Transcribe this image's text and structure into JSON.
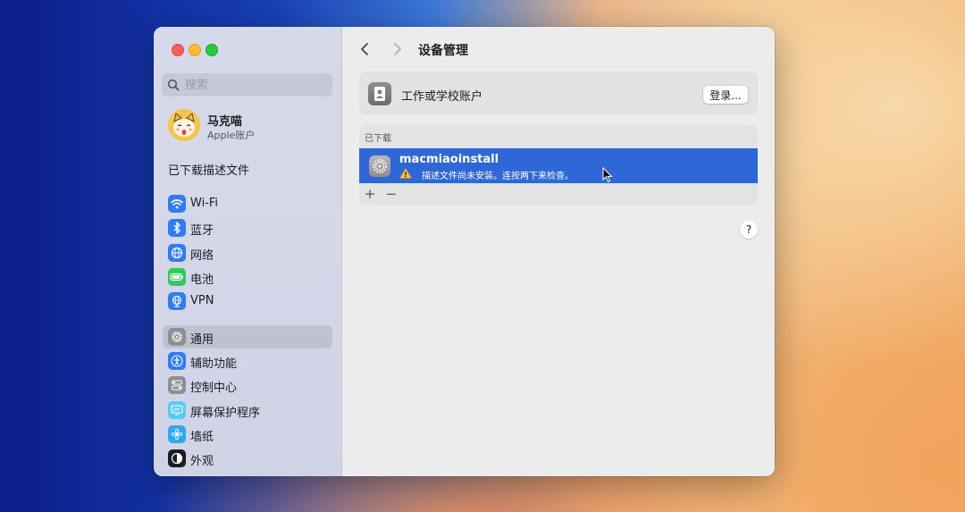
{
  "sidebar": {
    "search_placeholder": "搜索",
    "account": {
      "name": "马克喵",
      "subtitle": "Apple账户"
    },
    "downloaded_profiles_label": "已下载描述文件",
    "items": [
      {
        "label": "Wi-Fi",
        "icon": "wifi-icon",
        "color": "#2f7cf6"
      },
      {
        "label": "蓝牙",
        "icon": "bluetooth-icon",
        "color": "#2f7cf6"
      },
      {
        "label": "网络",
        "icon": "globe-icon",
        "color": "#2f7cf6"
      },
      {
        "label": "电池",
        "icon": "battery-icon",
        "color": "#34c759"
      },
      {
        "label": "VPN",
        "icon": "vpn-globe-icon",
        "color": "#2f7cf6"
      },
      {
        "label": "通用",
        "icon": "gear-icon",
        "color": "#8e8e93",
        "selected": true
      },
      {
        "label": "辅助功能",
        "icon": "accessibility-icon",
        "color": "#2f7cf6"
      },
      {
        "label": "控制中心",
        "icon": "control-center-icon",
        "color": "#8e8e93"
      },
      {
        "label": "屏幕保护程序",
        "icon": "screensaver-icon",
        "color": "#5ac8fa"
      },
      {
        "label": "墙纸",
        "icon": "wallpaper-icon",
        "color": "#32a8f0"
      },
      {
        "label": "外观",
        "icon": "appearance-icon",
        "color": "#1d1d1f"
      }
    ]
  },
  "main": {
    "title": "设备管理",
    "work_account": {
      "label": "工作或学校账户",
      "button": "登录..."
    },
    "downloaded": {
      "header": "已下载",
      "profile": {
        "name": "macmiaoinstall",
        "warning": "描述文件尚未安装。连按两下来检查。"
      },
      "add_label": "+",
      "remove_label": "−"
    },
    "help_label": "?"
  },
  "colors": {
    "selection": "#2f67d8",
    "accent": "#2f7cf6"
  }
}
